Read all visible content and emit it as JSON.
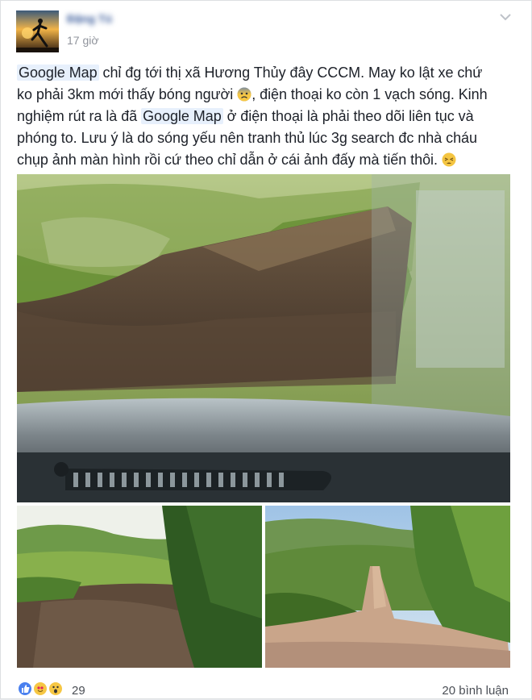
{
  "post": {
    "author_name": "Đặng Tú",
    "timestamp": "17 giờ",
    "text_lines": [
      [
        "",
        "Google Map",
        " chỉ đg tới thị xã Hương Thủy đây CCCM. May ko lật xe chứ"
      ],
      [
        "ko phải 3km mới thấy bóng người ",
        "",
        ", điện thoại ko còn 1 vạch sóng. Kinh"
      ],
      [
        "nghiệm rút ra là đã ",
        "Google Map",
        " ở điện thoại là phải theo dõi liên tục và"
      ],
      [
        "phóng to. Lưu ý là do sóng yếu nên tranh thủ lúc 3g search đc nhà cháu"
      ],
      [
        "chụp ảnh màn hình rồi cứ theo chỉ dẫn ở cái ảnh đấy mà tiến thôi. "
      ]
    ],
    "link_text": "Google Map",
    "emoji_icons": [
      "worried-face-emoji",
      "tired-face-emoji"
    ]
  },
  "photos": [
    {
      "name": "photo-dirt-road-windshield"
    },
    {
      "name": "photo-hills-trail-left"
    },
    {
      "name": "photo-hills-trail-right"
    }
  ],
  "footer": {
    "reaction_icons": [
      "like-icon",
      "love-icon",
      "wow-icon"
    ],
    "reaction_count": "29",
    "comments_label": "20 bình luận"
  },
  "colors": {
    "link_highlight": "#e7f0fc",
    "author_blue": "#365899",
    "meta_gray": "#90949c"
  }
}
